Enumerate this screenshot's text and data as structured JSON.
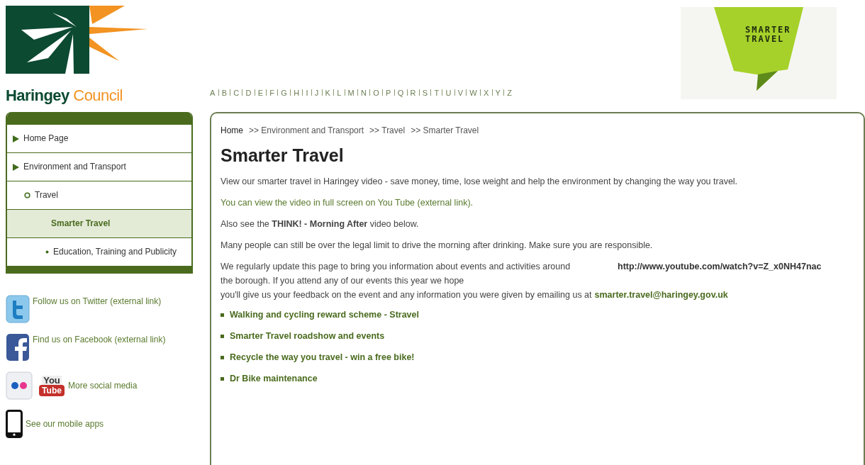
{
  "header": {
    "council_name_bold": "Haringey",
    "council_name_light": "Council",
    "alphabet": [
      "A",
      "B",
      "C",
      "D",
      "E",
      "F",
      "G",
      "H",
      "I",
      "J",
      "K",
      "L",
      "M",
      "N",
      "O",
      "P",
      "Q",
      "R",
      "S",
      "T",
      "U",
      "V",
      "W",
      "X",
      "Y",
      "Z"
    ],
    "banner_text": [
      "SMARTER",
      "TRAVEL"
    ]
  },
  "sidebar": {
    "nav": [
      {
        "label": "Home Page",
        "selected": false
      },
      {
        "label": "Environment and Transport",
        "selected": false,
        "children": [
          {
            "label": "Travel",
            "selected": false,
            "children": [
              {
                "label": "Smarter Travel",
                "selected": true
              },
              {
                "label": "Education, Training and Publicity",
                "selected": false
              }
            ]
          }
        ]
      }
    ],
    "social": [
      {
        "kind": "twitter",
        "label": "Follow us on Twitter (external link)"
      },
      {
        "kind": "facebook",
        "label": "Find us on Facebook (external link)"
      },
      {
        "kind": "more",
        "label": "More social media",
        "badge": [
          "You",
          "Tube"
        ]
      },
      {
        "kind": "mobile",
        "label": "See our mobile apps"
      }
    ]
  },
  "breadcrumb": [
    {
      "label": "Home"
    },
    {
      "label": ">> Environment and Transport"
    },
    {
      "label": ">> Travel"
    },
    {
      "label": ">> Smarter Travel"
    }
  ],
  "title": "Smarter Travel",
  "paragraphs": [
    {
      "kind": "text",
      "text": "View our smarter travel in Haringey video - save money, time, lose weight and help the environment by changing the way you travel."
    },
    {
      "kind": "link",
      "text": "You can view the video in full screen on You Tube (external link)."
    },
    {
      "kind": "text",
      "text": "Also see the **THINK! - Morning After** video below."
    },
    {
      "kind": "text",
      "text": "Many people can still be over the legal limit to drive the morning after drinking. Make sure you are responsible."
    }
  ],
  "events": {
    "text": "We regularly update this page to bring you information about events and activities around the borough. If you attend any of our events this year we hope",
    "continued": "you'll give us your feedback on the event and any information you were given by emailing us at",
    "email": "smarter.travel@haringey.gov.uk",
    "video_url": "http://www.youtube.com/watch?v=Z_x0NH47nac"
  },
  "links": [
    "Walking and cycling reward scheme - Stravel",
    "Smarter Travel roadshow and events",
    "Recycle the way you travel - win a free bike!",
    "Dr Bike maintenance"
  ]
}
